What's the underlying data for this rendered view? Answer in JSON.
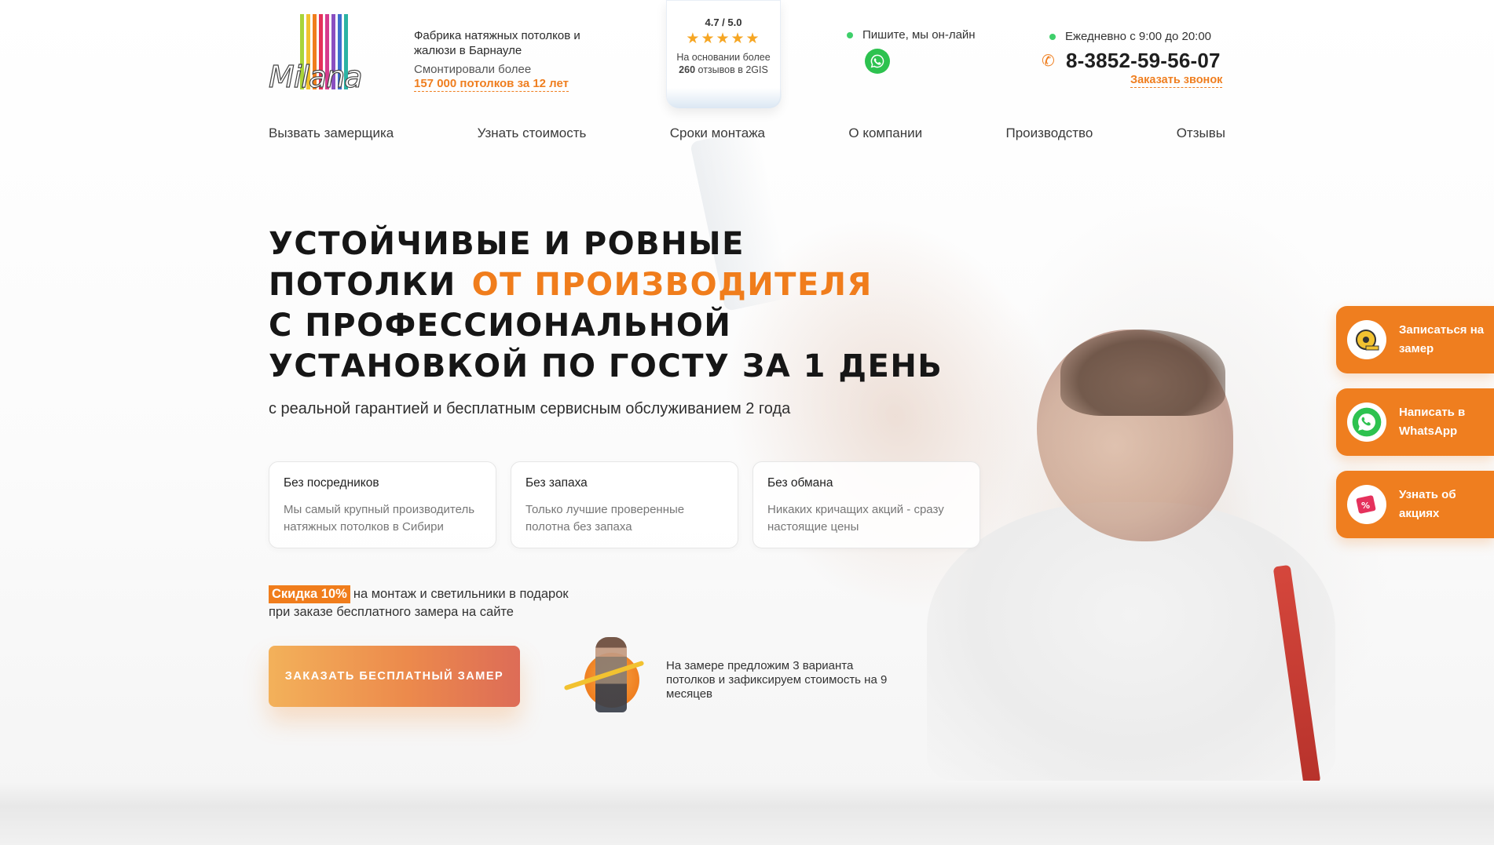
{
  "header": {
    "logo_text": "Milana",
    "logo_bar_colors": [
      "#a8d43a",
      "#f2c230",
      "#f07d1c",
      "#e5315c",
      "#d63b8e",
      "#8a4fc1",
      "#3f6fcf",
      "#2bb3a4"
    ],
    "tagline": "Фабрика натяжных потолков и жалюзи в Барнауле",
    "installed_prefix": "Смонтировали более",
    "installed_highlight": "157 000 потолков за 12 лет",
    "rating": {
      "score": "4.7 / 5.0",
      "stars": "★★★★★",
      "desc_prefix": "На основании более",
      "count": "260",
      "desc_suffix": "отзывов в 2GIS"
    },
    "online_text": "Пишите, мы он-лайн",
    "hours": "Ежедневно с 9:00 до 20:00",
    "phone": "8-3852-59-56-07",
    "callback": "Заказать звонок"
  },
  "nav": [
    "Вызвать замерщика",
    "Узнать стоимость",
    "Сроки монтажа",
    "О компании",
    "Производство",
    "Отзывы"
  ],
  "hero": {
    "line1": "Устойчивые и ровные",
    "line2_prefix": "потолки",
    "line2_highlight": "от производителя",
    "line3": "с профессиональной",
    "line4": "установкой по ГОСТу за 1 день",
    "subline": "с реальной гарантией и бесплатным сервисным обслуживанием 2 года"
  },
  "features": [
    {
      "title": "Без посредников",
      "text": "Мы самый крупный производитель натяжных потолков в Сибири"
    },
    {
      "title": "Без запаха",
      "text": "Только лучшие проверенные полотна без запаха"
    },
    {
      "title": "Без обмана",
      "text": "Никаких кричащих акций - сразу настоящие цены"
    }
  ],
  "promo": {
    "badge": "Скидка 10%",
    "line1": "на монтаж и светильники в подарок",
    "line2": "при заказе бесплатного замера на сайте"
  },
  "cta_label": "ЗАКАЗАТЬ БЕСПЛАТНЫЙ ЗАМЕР",
  "meter_note": "На замере предложим 3 варианта потолков и зафиксируем стоимость на 9 месяцев",
  "side_buttons": [
    {
      "label": "Записаться на замер",
      "icon": "tape-measure-icon"
    },
    {
      "label": "Написать в WhatsApp",
      "icon": "whatsapp-icon"
    },
    {
      "label": "Узнать об акциях",
      "icon": "discount-tag-icon"
    }
  ],
  "colors": {
    "accent": "#ef7e1f",
    "whatsapp": "#2dc24f"
  }
}
